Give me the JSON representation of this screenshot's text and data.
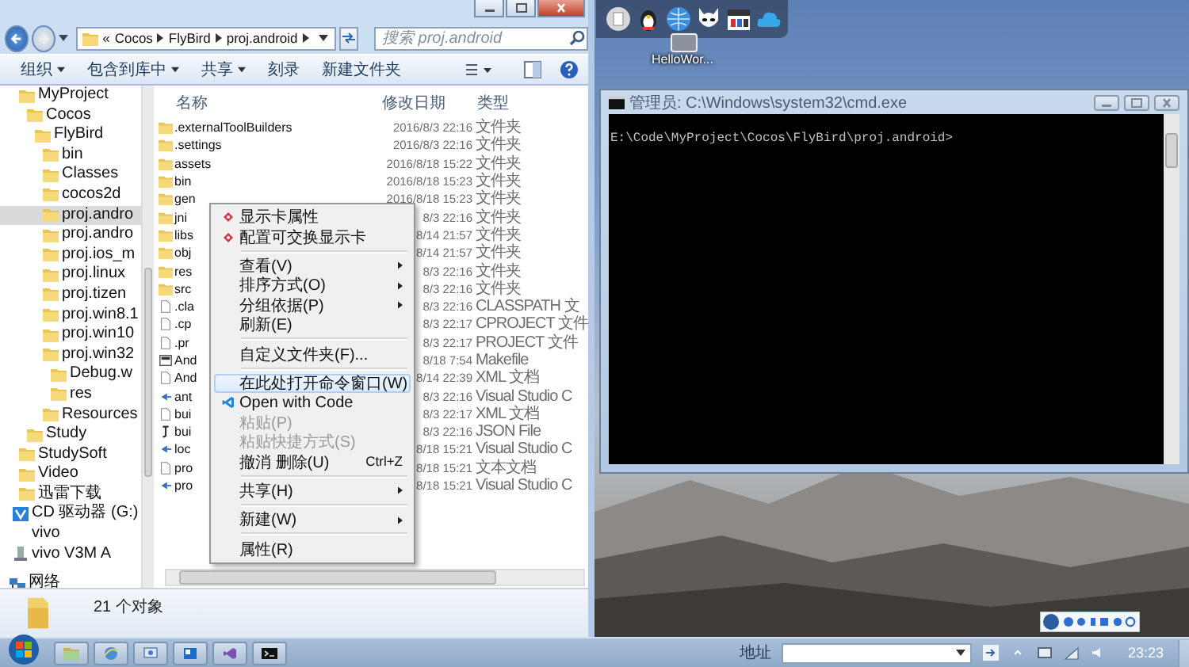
{
  "explorer": {
    "address": {
      "overflow": "«",
      "crumbs": [
        "Cocos",
        "FlyBird",
        "proj.android"
      ]
    },
    "search": {
      "placeholder": "搜索 proj.android"
    },
    "toolbar": [
      {
        "label": "组织",
        "dropdown": true
      },
      {
        "label": "包含到库中",
        "dropdown": true
      },
      {
        "label": "共享",
        "dropdown": true
      },
      {
        "label": "刻录",
        "dropdown": false
      },
      {
        "label": "新建文件夹",
        "dropdown": false
      }
    ],
    "nav_tree": [
      {
        "label": "MyProject",
        "selected": false,
        "children": [
          {
            "label": "Cocos",
            "selected": false,
            "children": [
              {
                "label": "FlyBird",
                "selected": false,
                "children": [
                  {
                    "label": "bin",
                    "selected": false
                  },
                  {
                    "label": "Classes",
                    "selected": false
                  },
                  {
                    "label": "cocos2d",
                    "selected": false
                  },
                  {
                    "label": "proj.andro",
                    "selected": true
                  },
                  {
                    "label": "proj.andro",
                    "selected": false
                  },
                  {
                    "label": "proj.ios_m",
                    "selected": false
                  },
                  {
                    "label": "proj.linux",
                    "selected": false
                  },
                  {
                    "label": "proj.tizen",
                    "selected": false
                  },
                  {
                    "label": "proj.win8.1",
                    "selected": false
                  },
                  {
                    "label": "proj.win10",
                    "selected": false
                  },
                  {
                    "label": "proj.win32",
                    "selected": false,
                    "children": [
                      {
                        "label": "Debug.w",
                        "selected": false
                      },
                      {
                        "label": "res",
                        "selected": false
                      }
                    ]
                  },
                  {
                    "label": "Resources",
                    "selected": false
                  }
                ]
              }
            ]
          },
          {
            "label": "Study",
            "selected": false
          }
        ]
      },
      {
        "label": "StudySoft",
        "selected": false
      },
      {
        "label": "Video",
        "selected": false
      },
      {
        "label": "迅雷下载",
        "selected": false
      }
    ],
    "nav_drives": [
      {
        "label": "CD 驱动器 (G:) vivo",
        "kind": "cd"
      },
      {
        "label": "vivo V3M A",
        "kind": "phone"
      }
    ],
    "nav_network": {
      "label": "网络"
    },
    "columns": [
      "名称",
      "修改日期",
      "类型"
    ],
    "rows": [
      {
        "name": ".externalToolBuilders",
        "date": "2016/8/3 22:16",
        "type": "文件夹",
        "kind": "folder"
      },
      {
        "name": ".settings",
        "date": "2016/8/3 22:16",
        "type": "文件夹",
        "kind": "folder"
      },
      {
        "name": "assets",
        "date": "2016/8/18 15:22",
        "type": "文件夹",
        "kind": "folder"
      },
      {
        "name": "bin",
        "date": "2016/8/18 15:23",
        "type": "文件夹",
        "kind": "folder"
      },
      {
        "name": "gen",
        "date": "2016/8/18 15:23",
        "type": "文件夹",
        "kind": "folder"
      },
      {
        "name": "jni",
        "date": "8/3 22:16",
        "type": "文件夹",
        "kind": "folder"
      },
      {
        "name": "libs",
        "date": "8/14 21:57",
        "type": "文件夹",
        "kind": "folder"
      },
      {
        "name": "obj",
        "date": "8/14 21:57",
        "type": "文件夹",
        "kind": "folder"
      },
      {
        "name": "res",
        "date": "8/3 22:16",
        "type": "文件夹",
        "kind": "folder"
      },
      {
        "name": "src",
        "date": "8/3 22:16",
        "type": "文件夹",
        "kind": "folder"
      },
      {
        "name": ".cla",
        "date": "8/3 22:16",
        "type": "CLASSPATH 文",
        "kind": "file"
      },
      {
        "name": ".cp",
        "date": "8/3 22:17",
        "type": "CPROJECT 文件",
        "kind": "file"
      },
      {
        "name": ".pr",
        "date": "8/3 22:17",
        "type": "PROJECT 文件",
        "kind": "file"
      },
      {
        "name": "And",
        "date": "8/18 7:54",
        "type": "Makefile",
        "kind": "makefile"
      },
      {
        "name": "And",
        "date": "8/14 22:39",
        "type": "XML 文档",
        "kind": "file"
      },
      {
        "name": "ant",
        "date": "8/3 22:16",
        "type": "Visual Studio C",
        "kind": "vs"
      },
      {
        "name": "bui",
        "date": "8/3 22:17",
        "type": "XML 文档",
        "kind": "file"
      },
      {
        "name": "bui",
        "date": "8/3 22:16",
        "type": "JSON File",
        "kind": "json"
      },
      {
        "name": "loc",
        "date": "8/18 15:21",
        "type": "Visual Studio C",
        "kind": "vs"
      },
      {
        "name": "pro",
        "date": "8/18 15:21",
        "type": "文本文档",
        "kind": "file"
      },
      {
        "name": "pro",
        "date": "8/18 15:21",
        "type": "Visual Studio C",
        "kind": "vs"
      }
    ],
    "status": "21 个对象"
  },
  "context_menu": [
    {
      "kind": "display-card-item",
      "label": "显示卡属性",
      "submenu": false,
      "disabled": false,
      "selected": false
    },
    {
      "kind": "display-card-item",
      "label": "配置可交换显示卡",
      "submenu": false,
      "disabled": false,
      "selected": false
    },
    {
      "kind": "separator"
    },
    {
      "kind": "item",
      "label": "查看(V)",
      "submenu": true,
      "disabled": false,
      "selected": false
    },
    {
      "kind": "item",
      "label": "排序方式(O)",
      "submenu": true,
      "disabled": false,
      "selected": false
    },
    {
      "kind": "item",
      "label": "分组依据(P)",
      "submenu": true,
      "disabled": false,
      "selected": false
    },
    {
      "kind": "item",
      "label": "刷新(E)",
      "submenu": false,
      "disabled": false,
      "selected": false
    },
    {
      "kind": "separator"
    },
    {
      "kind": "item",
      "label": "自定义文件夹(F)...",
      "submenu": false,
      "disabled": false,
      "selected": false
    },
    {
      "kind": "separator"
    },
    {
      "kind": "item",
      "label": "在此处打开命令窗口(W)",
      "submenu": false,
      "disabled": false,
      "selected": true
    },
    {
      "kind": "code-item",
      "label": "Open with Code",
      "submenu": false,
      "disabled": false,
      "selected": false
    },
    {
      "kind": "item",
      "label": "粘贴(P)",
      "submenu": false,
      "disabled": true,
      "selected": false
    },
    {
      "kind": "item",
      "label": "粘贴快捷方式(S)",
      "submenu": false,
      "disabled": true,
      "selected": false
    },
    {
      "kind": "item",
      "label": "撤消 删除(U)",
      "shortcut": "Ctrl+Z",
      "submenu": false,
      "disabled": false,
      "selected": false
    },
    {
      "kind": "separator"
    },
    {
      "kind": "item",
      "label": "共享(H)",
      "submenu": true,
      "disabled": false,
      "selected": false
    },
    {
      "kind": "separator"
    },
    {
      "kind": "item",
      "label": "新建(W)",
      "submenu": true,
      "disabled": false,
      "selected": false
    },
    {
      "kind": "separator"
    },
    {
      "kind": "item",
      "label": "属性(R)",
      "submenu": false,
      "disabled": false,
      "selected": false
    }
  ],
  "cmd": {
    "title": "管理员: C:\\Windows\\system32\\cmd.exe",
    "lines": [
      "E:\\Code\\MyProject\\Cocos\\FlyBird\\proj.android>"
    ]
  },
  "desktop_icon": {
    "label": "HelloWor..."
  },
  "taskbar": {
    "buttons": [
      {
        "kind": "explorer"
      },
      {
        "kind": "ie"
      },
      {
        "kind": "remote"
      },
      {
        "kind": "app"
      },
      {
        "kind": "vs"
      },
      {
        "kind": "cmd"
      }
    ],
    "address_label": "地址",
    "time": "23:23"
  }
}
